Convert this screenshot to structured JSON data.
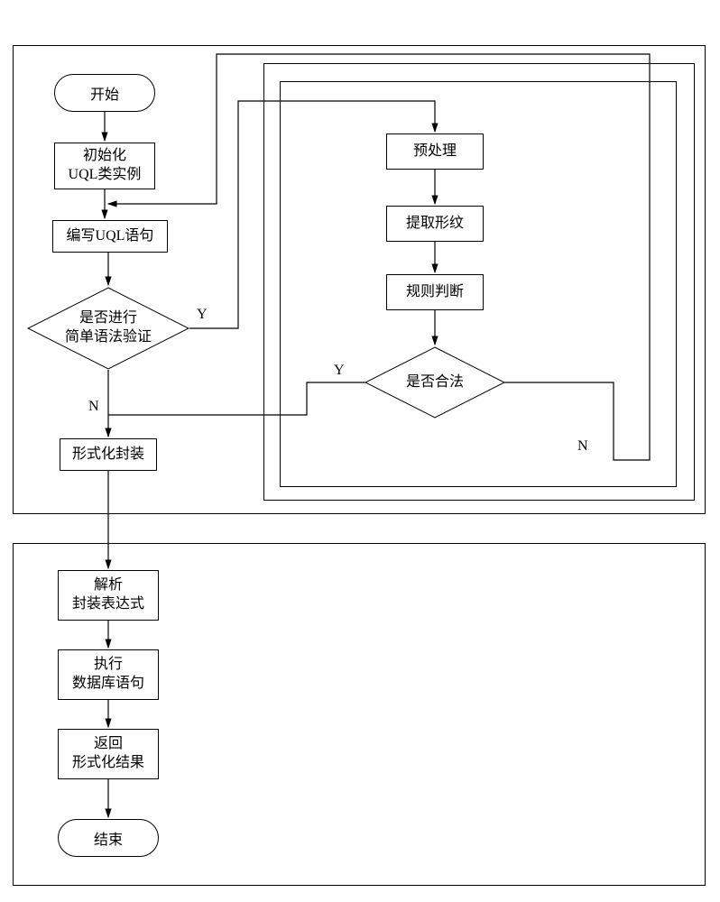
{
  "terminator": {
    "start": "开始",
    "end": "结束"
  },
  "left": {
    "init": "初始化\nUQL类实例",
    "write": "编写UQL语句",
    "validateQ": "是否进行\n简单语法验证",
    "encapsulate": "形式化封装"
  },
  "right": {
    "preprocess": "预处理",
    "extract": "提取形纹",
    "ruleJudge": "规则判断",
    "legalQ": "是否合法"
  },
  "bottom": {
    "parse": "解析\n封装表达式",
    "exec": "执行\n数据库语句",
    "ret": "返回\n形式化结果"
  },
  "branch": {
    "yes": "Y",
    "no": "N"
  },
  "chart_data": {
    "type": "flowchart",
    "nodes": [
      {
        "id": "start",
        "type": "terminator",
        "text": "开始"
      },
      {
        "id": "init",
        "type": "process",
        "text": "初始化UQL类实例"
      },
      {
        "id": "write",
        "type": "process",
        "text": "编写UQL语句"
      },
      {
        "id": "validate",
        "type": "decision",
        "text": "是否进行简单语法验证"
      },
      {
        "id": "encapsulate",
        "type": "process",
        "text": "形式化封装"
      },
      {
        "id": "preprocess",
        "type": "process",
        "text": "预处理"
      },
      {
        "id": "extract",
        "type": "process",
        "text": "提取形纹"
      },
      {
        "id": "rule",
        "type": "process",
        "text": "规则判断"
      },
      {
        "id": "legal",
        "type": "decision",
        "text": "是否合法"
      },
      {
        "id": "parse",
        "type": "process",
        "text": "解析封装表达式"
      },
      {
        "id": "exec",
        "type": "process",
        "text": "执行数据库语句"
      },
      {
        "id": "ret",
        "type": "process",
        "text": "返回形式化结果"
      },
      {
        "id": "end",
        "type": "terminator",
        "text": "结束"
      }
    ],
    "edges": [
      {
        "from": "start",
        "to": "init"
      },
      {
        "from": "init",
        "to": "write"
      },
      {
        "from": "write",
        "to": "validate"
      },
      {
        "from": "validate",
        "to": "preprocess",
        "label": "Y"
      },
      {
        "from": "validate",
        "to": "encapsulate",
        "label": "N"
      },
      {
        "from": "preprocess",
        "to": "extract"
      },
      {
        "from": "extract",
        "to": "rule"
      },
      {
        "from": "rule",
        "to": "legal"
      },
      {
        "from": "legal",
        "to": "encapsulate",
        "label": "Y"
      },
      {
        "from": "legal",
        "to": "write",
        "label": "N"
      },
      {
        "from": "encapsulate",
        "to": "parse"
      },
      {
        "from": "parse",
        "to": "exec"
      },
      {
        "from": "exec",
        "to": "ret"
      },
      {
        "from": "ret",
        "to": "end"
      }
    ],
    "groups": [
      {
        "name": "top-outer",
        "contains": [
          "start",
          "init",
          "write",
          "validate",
          "encapsulate",
          "preprocess",
          "extract",
          "rule",
          "legal"
        ]
      },
      {
        "name": "top-inner",
        "contains": [
          "preprocess",
          "extract",
          "rule",
          "legal"
        ]
      },
      {
        "name": "bottom",
        "contains": [
          "parse",
          "exec",
          "ret",
          "end"
        ]
      }
    ]
  }
}
